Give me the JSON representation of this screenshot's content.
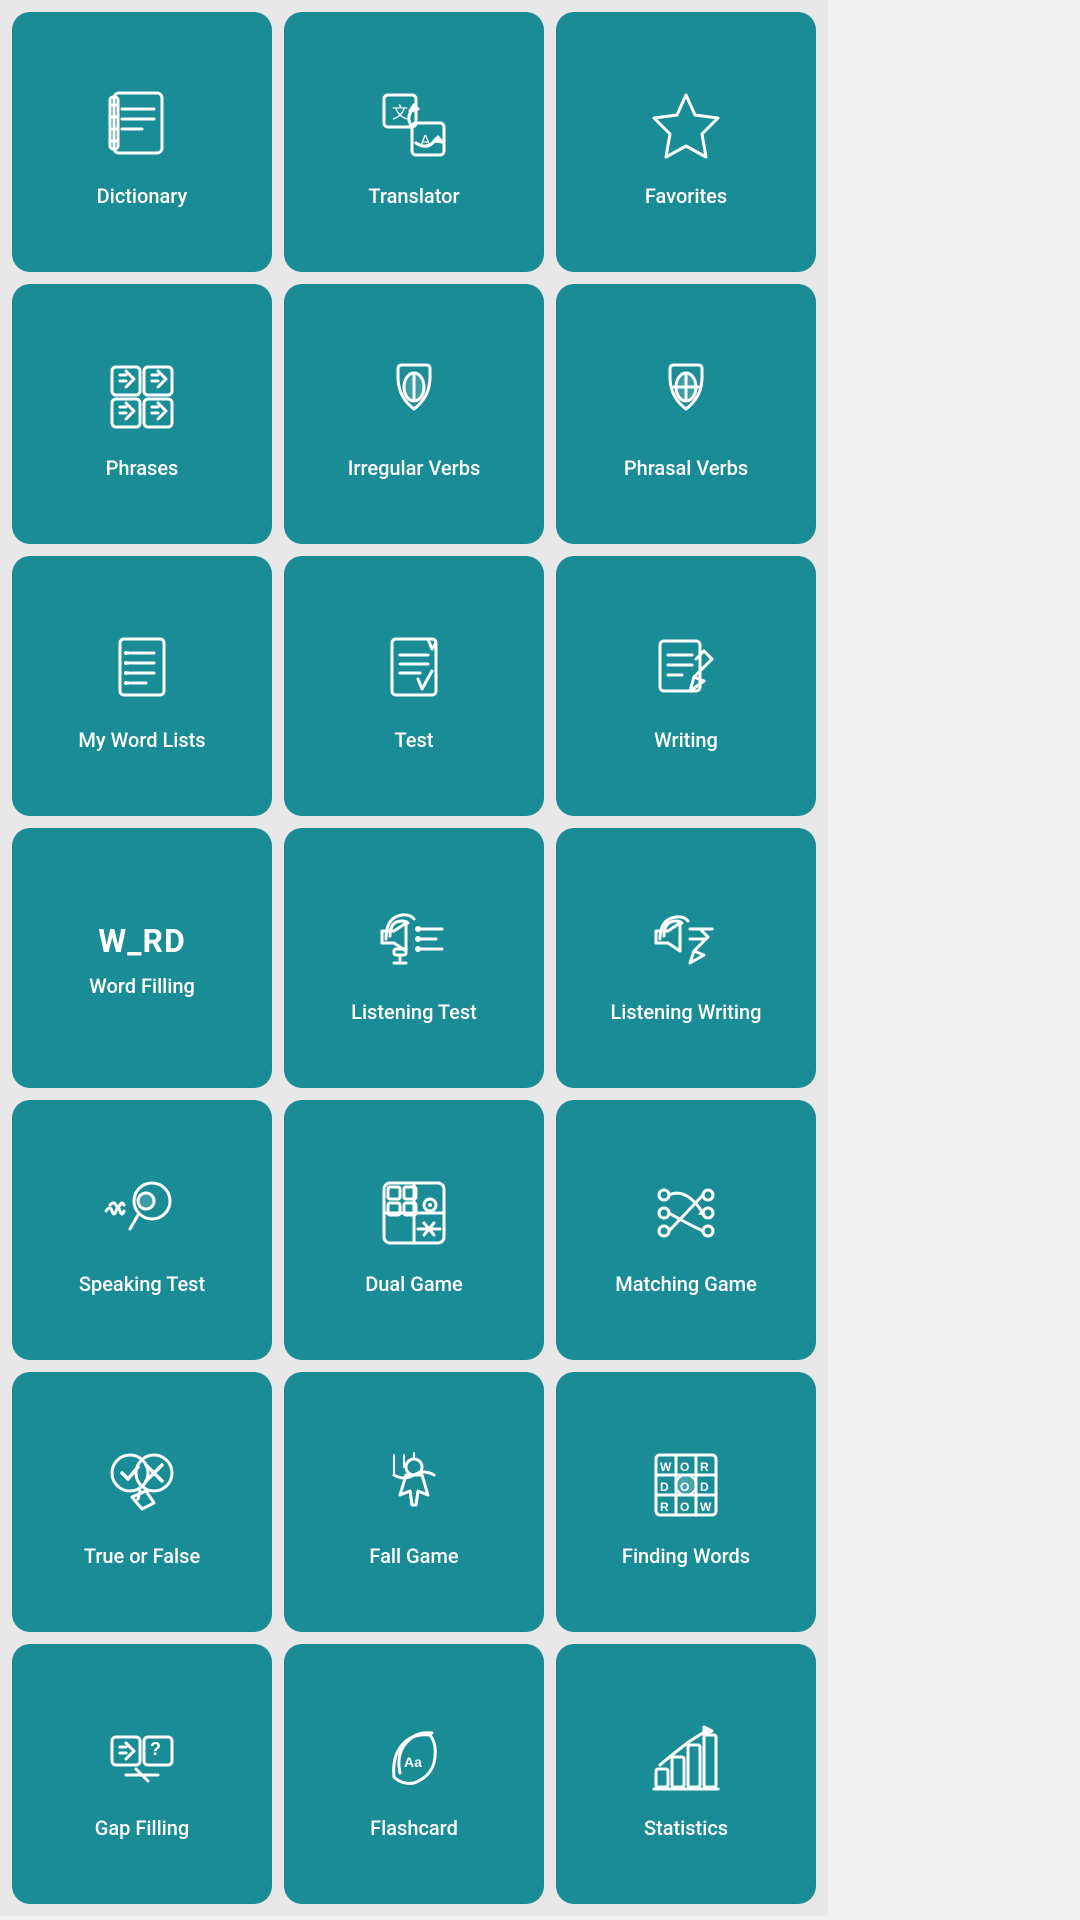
{
  "cards": [
    {
      "id": "dictionary",
      "label": "Dictionary"
    },
    {
      "id": "translator",
      "label": "Translator"
    },
    {
      "id": "favorites",
      "label": "Favorites"
    },
    {
      "id": "phrases",
      "label": "Phrases"
    },
    {
      "id": "irregular-verbs",
      "label": "Irregular Verbs"
    },
    {
      "id": "phrasal-verbs",
      "label": "Phrasal Verbs"
    },
    {
      "id": "my-word-lists",
      "label": "My Word Lists"
    },
    {
      "id": "test",
      "label": "Test"
    },
    {
      "id": "writing",
      "label": "Writing"
    },
    {
      "id": "word-filling",
      "label": "Word Filling"
    },
    {
      "id": "listening-test",
      "label": "Listening Test"
    },
    {
      "id": "listening-writing",
      "label": "Listening Writing"
    },
    {
      "id": "speaking-test",
      "label": "Speaking Test"
    },
    {
      "id": "dual-game",
      "label": "Dual Game"
    },
    {
      "id": "matching-game",
      "label": "Matching Game"
    },
    {
      "id": "true-or-false",
      "label": "True or False"
    },
    {
      "id": "fall-game",
      "label": "Fall Game"
    },
    {
      "id": "finding-words",
      "label": "Finding Words"
    },
    {
      "id": "gap-filling",
      "label": "Gap Filling"
    },
    {
      "id": "flashcard",
      "label": "Flashcard"
    },
    {
      "id": "statistics",
      "label": "Statistics"
    }
  ]
}
